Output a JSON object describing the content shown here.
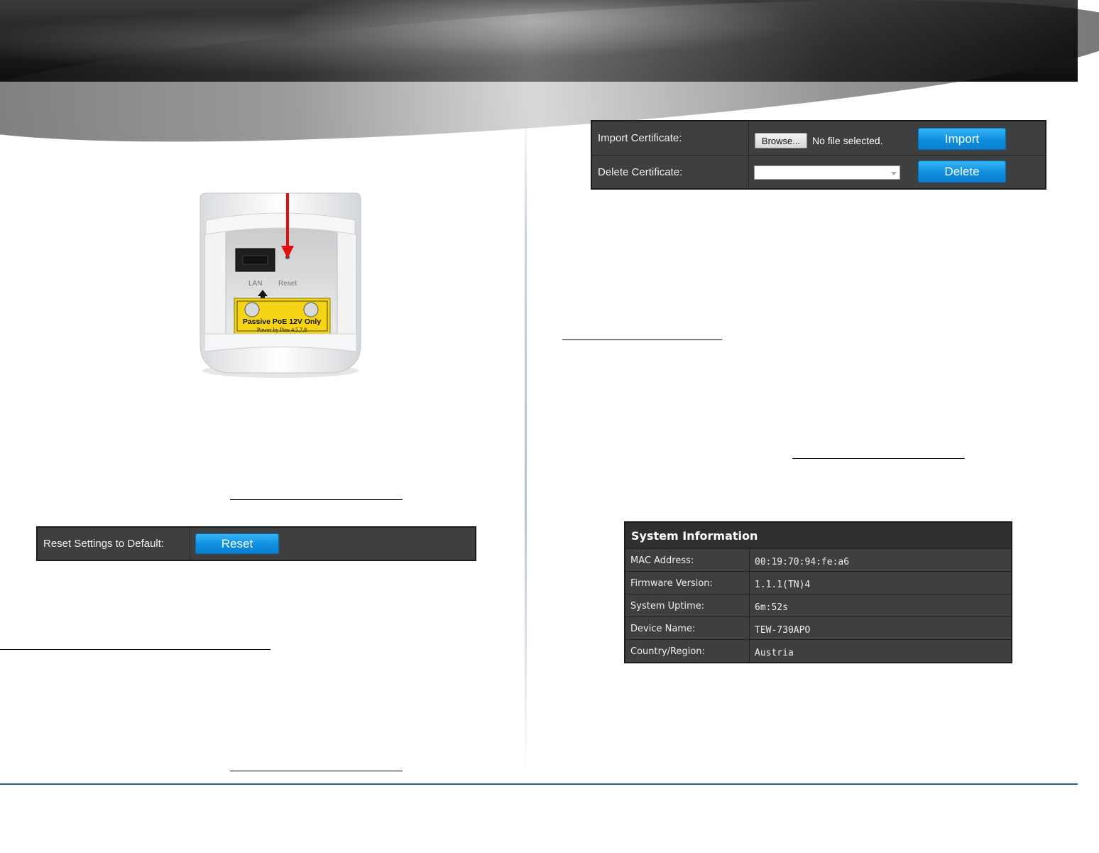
{
  "reset_panel": {
    "label": "Reset Settings to Default:",
    "button": "Reset"
  },
  "certificate_panel": {
    "import_label": "Import Certificate:",
    "browse_button": "Browse...",
    "file_status": "No file selected.",
    "import_button": "Import",
    "delete_label": "Delete Certificate:",
    "delete_select_value": "",
    "delete_button": "Delete"
  },
  "device_photo": {
    "port_label_lan": "LAN",
    "port_label_reset": "Reset",
    "sticker_line1": "Passive PoE 12V Only",
    "sticker_line2": "Power by Pins 4,5,7,8"
  },
  "system_information": {
    "title": "System Information",
    "rows": [
      {
        "key": "MAC Address:",
        "value": "00:19:70:94:fe:a6"
      },
      {
        "key": "Firmware Version:",
        "value": "1.1.1(TN)4"
      },
      {
        "key": "System Uptime:",
        "value": "6m:52s"
      },
      {
        "key": "Device Name:",
        "value": "TEW-730APO"
      },
      {
        "key": "Country/Region:",
        "value": "Austria"
      }
    ]
  },
  "colors": {
    "panel_bg": "#3e3f41",
    "button_blue": "#0f8edf",
    "footer_line": "#2d5c8f"
  }
}
